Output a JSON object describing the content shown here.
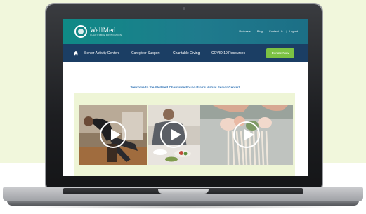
{
  "site": {
    "logo_name": "WellMed",
    "logo_tagline": "CHARITABLE FOUNDATION",
    "top_links": [
      "Podcasts",
      "Blog",
      "Contact Us",
      "Logout"
    ],
    "nav_items": [
      "Senior Activity Centers",
      "Caregiver Support",
      "Charitable Giving",
      "COVID 19 Resources"
    ],
    "donate_label": "Donate Now",
    "welcome": "Welcome to the WellMed Charitable Foundation's Virtual Senior Center!"
  },
  "videos": [
    {
      "subject": "exercise-class-video"
    },
    {
      "subject": "cooking-class-video"
    },
    {
      "subject": "macrame-craft-video"
    }
  ],
  "colors": {
    "header_teal": "#0f8a86",
    "nav_navy": "#1b3e64",
    "donate_green": "#7cc243",
    "welcome_blue": "#3f7dba",
    "page_background": "#f1f7dc"
  }
}
